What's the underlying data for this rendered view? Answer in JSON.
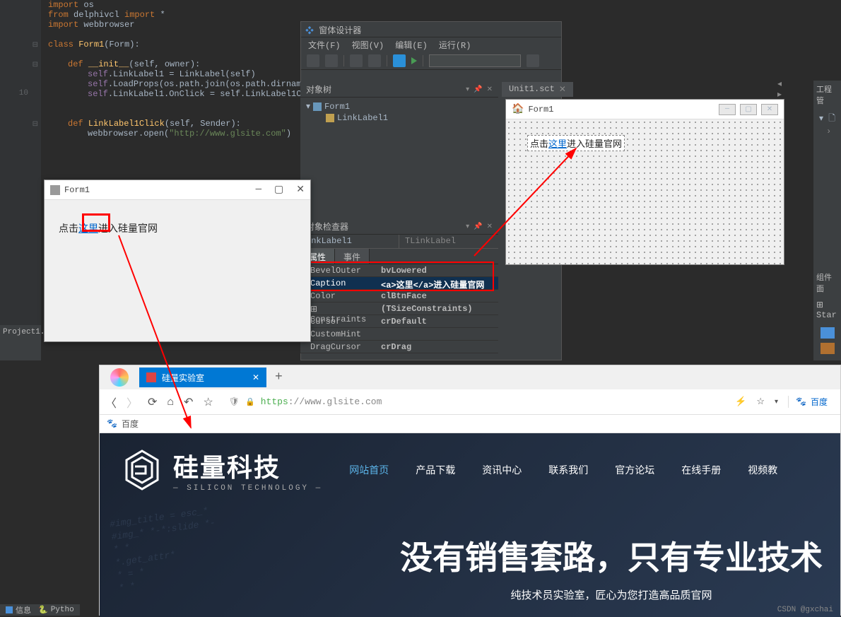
{
  "code": {
    "l1": "import os",
    "l2_from": "from ",
    "l2_mod": "delphivcl ",
    "l2_import": "import ",
    "l2_star": "*",
    "l3_import": "import ",
    "l3_mod": "webbrowser",
    "l5_class": "class ",
    "l5_name": "Form1",
    "l5_paren": "(Form):",
    "l7_def": "def ",
    "l7_name": "__init__",
    "l7_params": "(self, owner):",
    "l8_self": "self",
    "l8_rest": ".LinkLabel1 = LinkLabel(self)",
    "l9_self": "self",
    "l9_rest": ".LoadProps(os.path.join(os.path.dirname",
    "l10_self": "self",
    "l10_rest": ".LinkLabel1.OnClick = self.LinkLabel1C",
    "l12_def": "def ",
    "l12_name": "LinkLabel1Click",
    "l12_params": "(self, Sender):",
    "l13a": "webbrowser.open(",
    "l13b": "\"http://www.glsite.com\"",
    "l13c": ")",
    "line_number_10": "10"
  },
  "designer": {
    "title_icon": "❖",
    "title": "窗体设计器",
    "menu": {
      "file": "文件(F)",
      "view": "视图(V)",
      "edit": "编辑(E)",
      "run": "运行(R)"
    },
    "object_tree": "对象树",
    "tree_root": "Form1",
    "tree_child": "LinkLabel1",
    "inspector_head": "对象检查器",
    "inspector_name": "inkLabel1",
    "inspector_type": "TLinkLabel",
    "tab_props": "属性",
    "tab_events": "事件",
    "props": [
      {
        "name": "BevelOuter",
        "val": "bvLowered"
      },
      {
        "name": "Caption",
        "val": "<a>这里</a>进入硅量官网"
      },
      {
        "name": "Color",
        "val": "clBtnFace"
      },
      {
        "name": "Constraints",
        "val": "(TSizeConstraints)",
        "prefix": "⊞"
      },
      {
        "name": "Cursor",
        "val": "crDefault"
      },
      {
        "name": "CustomHint",
        "val": ""
      },
      {
        "name": "DragCursor",
        "val": "crDrag"
      }
    ]
  },
  "tabs": {
    "unit1": "Unit1.sct"
  },
  "right_side": {
    "project_mgr": "工程管",
    "component_panel": "组件面",
    "standard": "⊞ Star"
  },
  "design_form": {
    "icon": "🏠",
    "title": "Form1",
    "link_prefix": "点击",
    "link_text": "这里",
    "link_suffix": "进入硅量官网"
  },
  "form_run": {
    "title": "Form1",
    "prefix": "点击",
    "link": "这里",
    "suffix": "进入硅量官网"
  },
  "project": {
    "name": "Project1."
  },
  "browser": {
    "tab_title": "硅量实验室",
    "url_scheme": "https",
    "url_rest": "://www.glsite.com",
    "bookmark": "百度",
    "search_placeholder": "百度",
    "brand_cn": "硅量科技",
    "brand_en": "— SILICON TECHNOLOGY —",
    "nav": [
      "网站首页",
      "产品下载",
      "资讯中心",
      "联系我们",
      "官方论坛",
      "在线手册",
      "视频教"
    ],
    "hero_title": "没有销售套路，只有专业技术",
    "hero_sub": "纯技术员实验室，匠心为您打造高品质官网",
    "watermark": "CSDN @gxchai"
  },
  "status": {
    "info": "信息",
    "py": "Pytho"
  }
}
